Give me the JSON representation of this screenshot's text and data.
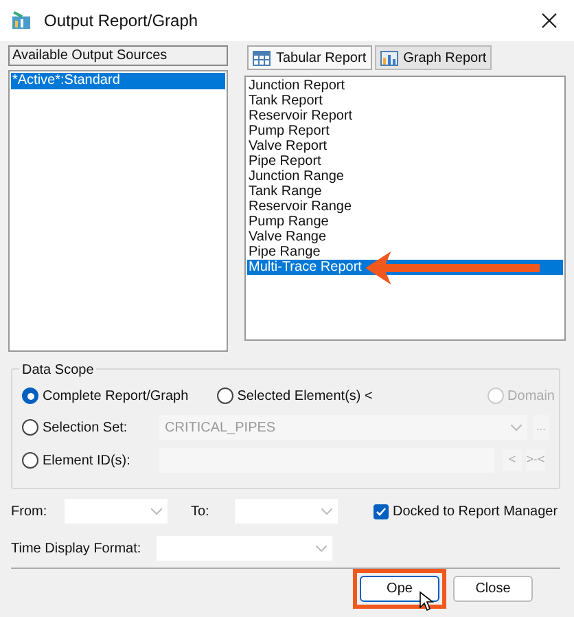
{
  "window": {
    "title": "Output Report/Graph"
  },
  "sources": {
    "header": "Available Output Sources",
    "items": [
      {
        "label": "*Active*:Standard",
        "selected": true
      }
    ]
  },
  "tabs": [
    {
      "label": "Tabular Report",
      "selected": true,
      "kind": "table"
    },
    {
      "label": "Graph Report",
      "selected": false,
      "kind": "graph"
    }
  ],
  "reports": [
    {
      "label": "Junction Report",
      "selected": false
    },
    {
      "label": "Tank Report",
      "selected": false
    },
    {
      "label": "Reservoir Report",
      "selected": false
    },
    {
      "label": "Pump Report",
      "selected": false
    },
    {
      "label": "Valve Report",
      "selected": false
    },
    {
      "label": "Pipe Report",
      "selected": false
    },
    {
      "label": "Junction Range",
      "selected": false
    },
    {
      "label": "Tank Range",
      "selected": false
    },
    {
      "label": "Reservoir Range",
      "selected": false
    },
    {
      "label": "Pump Range",
      "selected": false
    },
    {
      "label": "Valve Range",
      "selected": false
    },
    {
      "label": "Pipe Range",
      "selected": false
    },
    {
      "label": "Multi-Trace Report",
      "selected": true
    }
  ],
  "data_scope": {
    "title": "Data Scope",
    "options": [
      {
        "label": "Complete Report/Graph",
        "selected": true,
        "disabled": false
      },
      {
        "label": "Selected Element(s) <",
        "selected": false,
        "disabled": false
      },
      {
        "label": "Domain",
        "selected": false,
        "disabled": true
      },
      {
        "label": "Selection Set:",
        "selected": false,
        "disabled": false
      },
      {
        "label": "Element ID(s):",
        "selected": false,
        "disabled": false
      }
    ],
    "selection_set": {
      "value": "CRITICAL_PIPES",
      "browse": "...",
      "disabled": true
    },
    "element_ids": {
      "buttons": [
        "<",
        ">-<"
      ],
      "disabled": true
    }
  },
  "from": {
    "label": "From:"
  },
  "to": {
    "label": "To:"
  },
  "docked": {
    "label": "Docked to Report Manager",
    "checked": true
  },
  "time_format": {
    "label": "Time Display Format:"
  },
  "buttons": [
    {
      "label": "Ope",
      "highlighted": true
    },
    {
      "label": "Close",
      "highlighted": false
    }
  ]
}
